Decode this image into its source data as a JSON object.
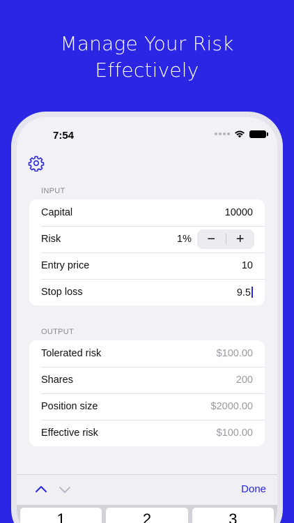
{
  "headline": {
    "line1": "Manage Your Risk",
    "line2": "Effectively"
  },
  "status": {
    "time": "7:54"
  },
  "input": {
    "section_label": "INPUT",
    "capital": {
      "label": "Capital",
      "value": "10000"
    },
    "risk": {
      "label": "Risk",
      "value": "1%",
      "minus": "−",
      "plus": "+"
    },
    "entry": {
      "label": "Entry price",
      "value": "10"
    },
    "stop": {
      "label": "Stop loss",
      "value": "9.5"
    }
  },
  "output": {
    "section_label": "OUTPUT",
    "tolerated": {
      "label": "Tolerated risk",
      "value": "$100.00"
    },
    "shares": {
      "label": "Shares",
      "value": "200"
    },
    "position": {
      "label": "Position size",
      "value": "$2000.00"
    },
    "effective": {
      "label": "Effective risk",
      "value": "$100.00"
    }
  },
  "keyboard": {
    "done_label": "Done",
    "keys": [
      "1",
      "2",
      "3"
    ]
  },
  "icons": {
    "settings": "gear-icon",
    "prev": "chevron-up-icon",
    "next": "chevron-down-icon",
    "wifi": "wifi-icon",
    "battery": "battery-icon",
    "signal": "signal-dots-icon"
  },
  "colors": {
    "accent": "#2a26e3",
    "background": "#f2f1f6",
    "muted": "#9a9aa0"
  }
}
